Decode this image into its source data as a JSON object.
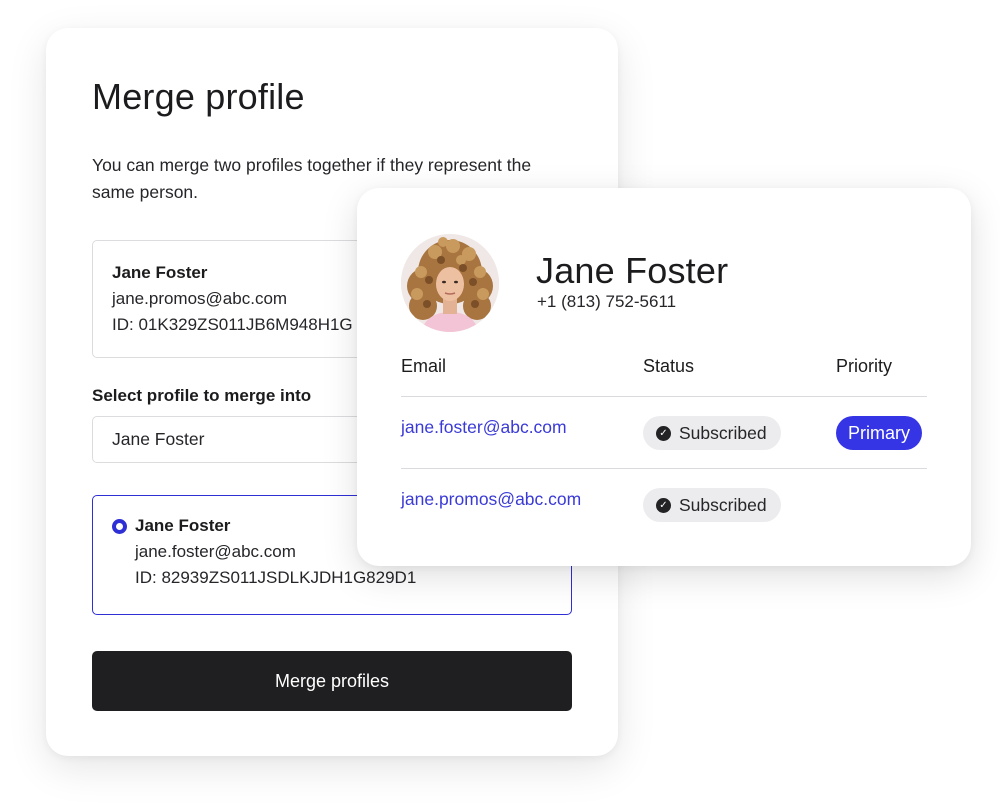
{
  "merge_panel": {
    "title": "Merge profile",
    "description": "You can merge two profiles together if they represent the same person.",
    "source_profile": {
      "name": "Jane Foster",
      "email": "jane.promos@abc.com",
      "id": "ID: 01K329ZS011JB6M948H1G"
    },
    "select_label": "Select profile to merge into",
    "select_value": "Jane Foster",
    "target_profile": {
      "name": "Jane Foster",
      "email": "jane.foster@abc.com",
      "id": "ID: 82939ZS011JSDLKJDH1G829D1",
      "selected": true
    },
    "merge_button": "Merge profiles"
  },
  "contact_card": {
    "name": "Jane Foster",
    "phone": "+1 (813) 752-5611",
    "avatar_icon": "profile-photo",
    "columns": [
      "Email",
      "Status",
      "Priority"
    ],
    "rows": [
      {
        "email": "jane.foster@abc.com",
        "status": "Subscribed",
        "priority": "Primary"
      },
      {
        "email": "jane.promos@abc.com",
        "status": "Subscribed",
        "priority": ""
      }
    ]
  },
  "colors": {
    "accent": "#3535e6",
    "link": "#3a3ad6",
    "button_bg": "#1f1f21",
    "status_pill_bg": "#ececee"
  }
}
